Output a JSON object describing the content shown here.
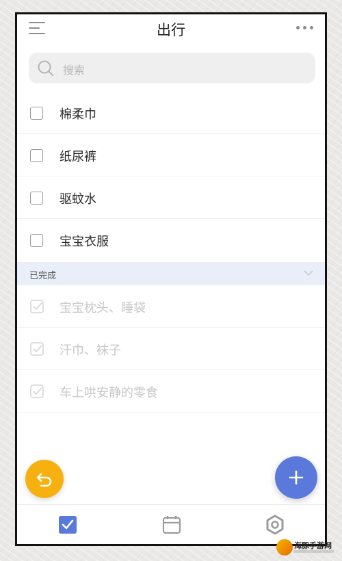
{
  "header": {
    "title": "出行"
  },
  "search": {
    "placeholder": "搜索"
  },
  "todo_items": [
    {
      "label": "棉柔巾",
      "checked": false
    },
    {
      "label": "纸尿裤",
      "checked": false
    },
    {
      "label": "驱蚊水",
      "checked": false
    },
    {
      "label": "宝宝衣服",
      "checked": false
    }
  ],
  "completed_section": {
    "label": "已完成",
    "items": [
      {
        "label": "宝宝枕头、睡袋",
        "checked": true
      },
      {
        "label": "汗巾、袜子",
        "checked": true
      },
      {
        "label": "车上哄安静的零食",
        "checked": true
      }
    ]
  },
  "bottom_nav": {
    "items": [
      {
        "icon": "checkbox-icon",
        "active": true
      },
      {
        "icon": "calendar-icon",
        "active": false
      },
      {
        "icon": "gear-icon",
        "active": false
      }
    ]
  },
  "colors": {
    "accent": "#5b79db",
    "undo_fab": "#f6b111",
    "completed_header_bg": "#e9eef9"
  },
  "watermark": {
    "text": "海豚手游网"
  }
}
